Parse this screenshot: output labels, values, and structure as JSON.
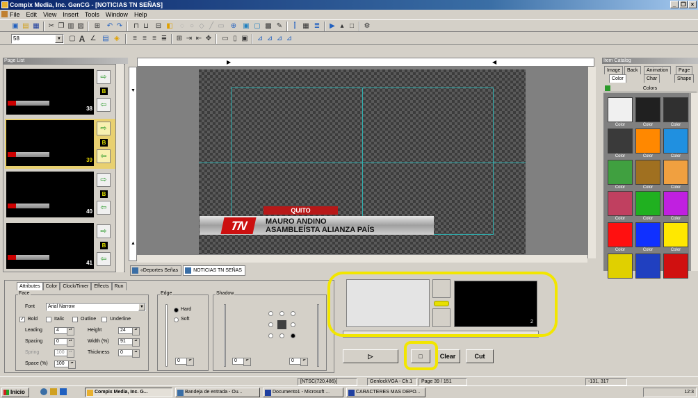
{
  "window": {
    "title": "Compix Media, Inc. GenCG - [NOTICIAS TN SEÑAS]",
    "min": "_",
    "restore": "❐",
    "close": "×"
  },
  "menu": [
    "File",
    "Edit",
    "View",
    "Insert",
    "Tools",
    "Window",
    "Help"
  ],
  "format_bar": {
    "font_size": "58",
    "bold_label": "A"
  },
  "page_list": {
    "title": "Page List",
    "pages": [
      {
        "number": "38",
        "selected": false
      },
      {
        "number": "39",
        "selected": true
      },
      {
        "number": "40",
        "selected": false
      },
      {
        "number": "41",
        "selected": false
      }
    ],
    "badge": "B"
  },
  "canvas": {
    "lower_third": {
      "logo": "TN",
      "tag": "QUITO",
      "line1": "MAURO ANDINO",
      "line2": "ASAMBLEÍSTA ALIANZA PAÍS"
    }
  },
  "doc_tabs": [
    "«Deportes Señas",
    "NOTICIAS TN SEÑAS"
  ],
  "catalog": {
    "title": "Item Catalog",
    "tabs_row1": [
      "Image",
      "Back",
      "Animation",
      "Page"
    ],
    "tabs_row2": [
      "Color",
      "Char",
      "Shape"
    ],
    "section": "Colors",
    "swatches": [
      {
        "label": "Color",
        "fill": "#f0f0f0"
      },
      {
        "label": "Color",
        "fill": "#202020"
      },
      {
        "label": "Color",
        "fill": "#303030"
      },
      {
        "label": "Color",
        "fill": "#3a3a3a"
      },
      {
        "label": "Color",
        "fill": "#ff8800"
      },
      {
        "label": "Color",
        "fill": "#2090e0"
      },
      {
        "label": "Color",
        "fill": "#40a040"
      },
      {
        "label": "Color",
        "fill": "#a07020"
      },
      {
        "label": "Color",
        "fill": "#f0a040"
      },
      {
        "label": "Color",
        "fill": "#c04060"
      },
      {
        "label": "Color",
        "fill": "#20b020"
      },
      {
        "label": "Color",
        "fill": "#c020e0"
      },
      {
        "label": "Color",
        "fill": "#ff1010"
      },
      {
        "label": "Color",
        "fill": "#1030ff"
      },
      {
        "label": "Color",
        "fill": "#ffe800"
      },
      {
        "label": "Color",
        "fill": "#e0d000"
      },
      {
        "label": "Color",
        "fill": "#2040c0"
      },
      {
        "label": "Color",
        "fill": "#d01010"
      }
    ]
  },
  "attributes": {
    "tabs": [
      "Attributes",
      "Color",
      "Clock/Timer",
      "Effects",
      "Run"
    ],
    "face_group": "Face",
    "font_label": "Font",
    "font_value": "Arial Narrow",
    "bold": "Bold",
    "italic": "Italic",
    "outline": "Outline",
    "underline": "Underline",
    "leading_label": "Leading",
    "leading_value": "4",
    "height_label": "Height",
    "height_value": "24",
    "spacing_label": "Spacing",
    "spacing_value": "0",
    "width_label": "Width (%)",
    "width_value": "91",
    "spring_label": "Spring",
    "spring_value": "100",
    "thickness_label": "Thickness",
    "thickness_value": "0",
    "space_label": "Space (%)",
    "space_value": "100",
    "edge_group": "Edge",
    "hard": "Hard",
    "soft": "Soft",
    "edge_value": "0",
    "shadow_group": "Shadow",
    "shadow_value1": "0",
    "shadow_value2": "0"
  },
  "preview": {
    "number": "2"
  },
  "controls": {
    "play": "▷",
    "stop": "□",
    "clear": "Clear",
    "cut": "Cut"
  },
  "status": {
    "format": "[NTSC(720,486)]",
    "device": "GenlockVGA - Ch.1",
    "page": "Page 39 / 151",
    "coords": "-131, 317"
  },
  "taskbar": {
    "start": "Inicio",
    "items": [
      "Compix Media, Inc. G...",
      "Bandeja de entrada - Ou...",
      "Documento1 - Microsoft ...",
      "CARACTERES MAS DEPO..."
    ],
    "clock": "12:3"
  }
}
